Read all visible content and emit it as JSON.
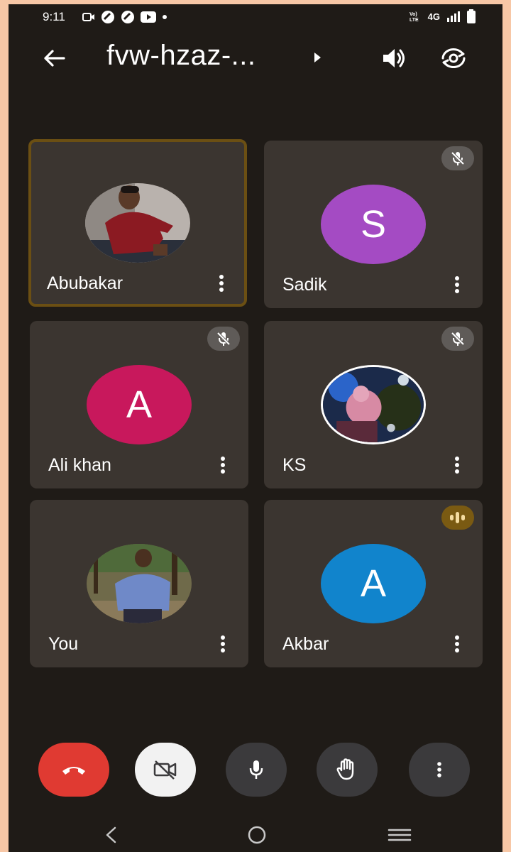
{
  "status_bar": {
    "time": "9:11",
    "network": "4G"
  },
  "header": {
    "meeting_code": "fvw-hzaz-..."
  },
  "participants": [
    {
      "name": "Abubakar",
      "avatar_type": "photo",
      "muted": false,
      "active_speaker": true
    },
    {
      "name": "Sadik",
      "avatar_type": "initial",
      "initial": "S",
      "avatar_color": "#a44bc3",
      "muted": true
    },
    {
      "name": "Ali khan",
      "avatar_type": "initial",
      "initial": "A",
      "avatar_color": "#c8185c",
      "muted": true
    },
    {
      "name": "KS",
      "avatar_type": "photo",
      "muted": true
    },
    {
      "name": "You",
      "avatar_type": "photo",
      "muted": false
    },
    {
      "name": "Akbar",
      "avatar_type": "initial",
      "initial": "A",
      "avatar_color": "#1184cc",
      "speaking": true
    }
  ],
  "controls": {
    "end_call_icon": "phone-hangup-icon",
    "camera_icon": "video-off-icon",
    "mic_icon": "mic-icon",
    "hand_icon": "raise-hand-icon",
    "more_icon": "more-vert-icon"
  },
  "colors": {
    "background": "#1f1b17",
    "tile": "#3b3530",
    "end_call": "#e03a32",
    "active_border": "#6b4f13"
  }
}
